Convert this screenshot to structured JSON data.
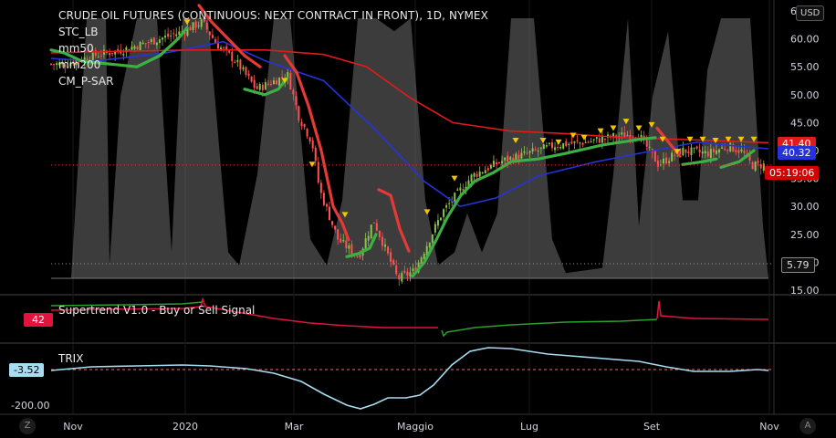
{
  "header": {
    "title": "CRUDE OIL FUTURES (CONTINUOUS: NEXT CONTRACT IN FRONT), 1D, NYMEX",
    "indicators": [
      "STC_LB",
      "mm50",
      "mm200",
      "CM_P-SAR"
    ]
  },
  "currency_button": "USD",
  "badges": {
    "price_red": "41.40",
    "price_blue": "40.32",
    "countdown": "05:19:06",
    "stc_value": "5.79",
    "supertrend_value": "42",
    "trix_value": "-3.52"
  },
  "panes": {
    "supertrend_label": "Supertrend V1.0 - Buy or Sell Signal",
    "trix_label": "TRIX",
    "trix_tick": "-200.00"
  },
  "buttons": {
    "left": "Z",
    "right": "A"
  },
  "colors": {
    "background": "#000000",
    "up": "#8bc34a",
    "down": "#ff5252",
    "mm50": "#2633d9",
    "mm200": "#e01b1b",
    "stc": "#c8c8c8",
    "sar_up": "#3cb043",
    "sar_down": "#e53935",
    "marker": "#f2c500",
    "supertrend_up": "#2ca02c",
    "supertrend_down": "#e0143c",
    "trix": "#a8dcf0"
  },
  "chart_data": {
    "type": "candlestick",
    "ylim": [
      15,
      65
    ],
    "y_ticks": [
      "15.00",
      "20.00",
      "25.00",
      "30.00",
      "35.00",
      "40.00",
      "45.00",
      "50.00",
      "55.00",
      "60.00",
      "6"
    ],
    "x_ticks": [
      "Nov",
      "2020",
      "Mar",
      "Maggio",
      "Lug",
      "Set",
      "Nov"
    ],
    "price_path": [
      [
        "2019-10-25",
        55.5
      ],
      [
        "2019-11-10",
        57.0
      ],
      [
        "2019-11-25",
        58.0
      ],
      [
        "2019-12-10",
        59.5
      ],
      [
        "2019-12-25",
        61.0
      ],
      [
        "2020-01-07",
        63.0
      ],
      [
        "2020-01-15",
        59.0
      ],
      [
        "2020-01-25",
        56.0
      ],
      [
        "2020-02-05",
        51.0
      ],
      [
        "2020-02-15",
        52.5
      ],
      [
        "2020-02-22",
        53.5
      ],
      [
        "2020-02-28",
        46.0
      ],
      [
        "2020-03-06",
        41.5
      ],
      [
        "2020-03-10",
        33.0
      ],
      [
        "2020-03-20",
        24.0
      ],
      [
        "2020-03-31",
        21.0
      ],
      [
        "2020-04-08",
        27.5
      ],
      [
        "2020-04-21",
        17.0
      ],
      [
        "2020-04-30",
        18.5
      ],
      [
        "2020-05-15",
        29.0
      ],
      [
        "2020-05-31",
        35.5
      ],
      [
        "2020-06-15",
        38.0
      ],
      [
        "2020-06-30",
        39.5
      ],
      [
        "2020-07-15",
        41.0
      ],
      [
        "2020-07-31",
        41.5
      ],
      [
        "2020-08-15",
        42.5
      ],
      [
        "2020-08-28",
        43.0
      ],
      [
        "2020-09-08",
        37.5
      ],
      [
        "2020-09-20",
        40.0
      ],
      [
        "2020-10-05",
        39.5
      ],
      [
        "2020-10-15",
        40.8
      ],
      [
        "2020-10-23",
        39.8
      ],
      [
        "2020-10-28",
        37.4
      ]
    ],
    "series": [
      {
        "name": "mm50",
        "values": [
          [
            0,
            56.5
          ],
          [
            0.06,
            56.0
          ],
          [
            0.16,
            57.5
          ],
          [
            0.24,
            59.5
          ],
          [
            0.3,
            56.0
          ],
          [
            0.38,
            52.5
          ],
          [
            0.45,
            44.0
          ],
          [
            0.52,
            34.5
          ],
          [
            0.57,
            30.0
          ],
          [
            0.62,
            31.5
          ],
          [
            0.68,
            35.5
          ],
          [
            0.76,
            38.0
          ],
          [
            0.84,
            40.0
          ],
          [
            0.9,
            41.5
          ],
          [
            0.94,
            41.0
          ],
          [
            1.0,
            40.32
          ]
        ]
      },
      {
        "name": "mm200",
        "values": [
          [
            0,
            57.5
          ],
          [
            0.1,
            57.8
          ],
          [
            0.2,
            58.0
          ],
          [
            0.3,
            58.0
          ],
          [
            0.38,
            57.2
          ],
          [
            0.44,
            55.0
          ],
          [
            0.5,
            49.5
          ],
          [
            0.56,
            45.0
          ],
          [
            0.64,
            43.5
          ],
          [
            0.72,
            43.0
          ],
          [
            0.8,
            42.3
          ],
          [
            0.88,
            42.0
          ],
          [
            0.94,
            41.7
          ],
          [
            1.0,
            41.4
          ]
        ]
      }
    ],
    "last_price": 37.4
  }
}
